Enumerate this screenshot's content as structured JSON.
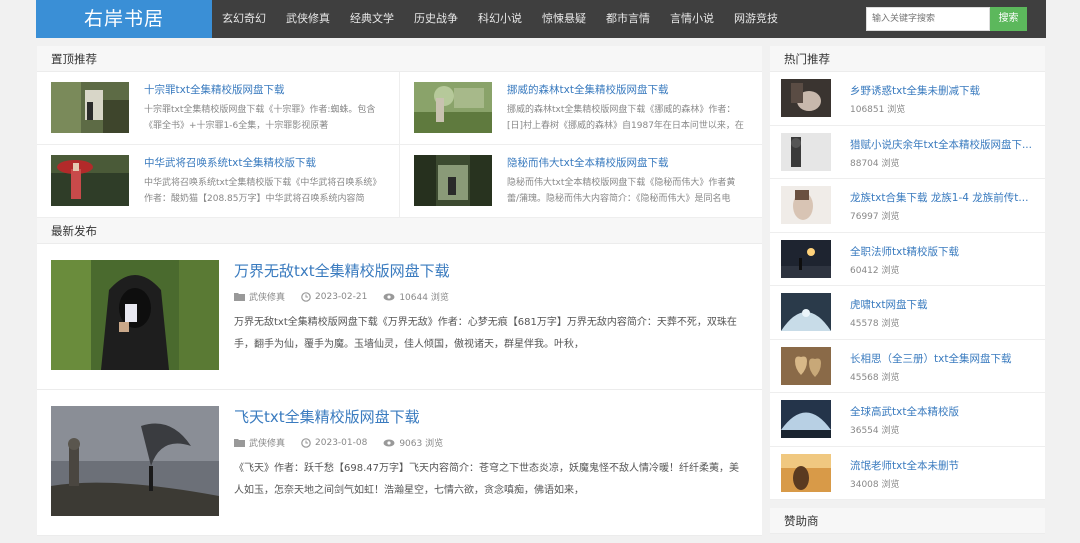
{
  "header": {
    "logo": "右岸书居",
    "menu": [
      "玄幻奇幻",
      "武侠修真",
      "经典文学",
      "历史战争",
      "科幻小说",
      "惊悚悬疑",
      "都市言情",
      "言情小说",
      "网游竞技"
    ],
    "search_placeholder": "输入关键字搜索",
    "search_button": "搜索"
  },
  "pinned": {
    "heading": "置顶推荐",
    "items": [
      {
        "title": "十宗罪txt全集精校版网盘下载",
        "desc": "十宗罪txt全集精校版网盘下载《十宗罪》作者:蜘蛛。包含《罪全书》+十宗罪1-6全集，十宗罪影视原著"
      },
      {
        "title": "挪威的森林txt全集精校版网盘下载",
        "desc": "挪威的森林txt全集精校版网盘下载《挪威的森林》作者：[日]村上春树《挪威的森林》自1987年在日本问世以来，在"
      },
      {
        "title": "中华武将召唤系统txt全集精校版下载",
        "desc": "中华武将召唤系统txt全集精校版下载《中华武将召唤系统》作者：酸奶猫【208.85万字】中华武将召唤系统内容简"
      },
      {
        "title": "隐秘而伟大txt全本精校版网盘下载",
        "desc": "隐秘而伟大txt全本精校版网盘下载《隐秘而伟大》作者黄蕾/蒲瑰。隐秘而伟大内容简介：《隐秘而伟大》是同名电"
      }
    ]
  },
  "latest": {
    "heading": "最新发布",
    "posts": [
      {
        "title": "万界无敌txt全集精校版网盘下载",
        "category": "武侠修真",
        "date": "2023-02-21",
        "views": "10644 浏览",
        "desc": "万界无敌txt全集精校版网盘下载《万界无敌》作者：心梦无痕【681万字】万界无敌内容简介：天葬不死，双珠在手，翻手为仙，覆手为魔。玉墙仙灵，佳人倾国，傲视诸天，群星伴我。叶秋，"
      },
      {
        "title": "飞天txt全集精校版网盘下载",
        "category": "武侠修真",
        "date": "2023-01-08",
        "views": "9063 浏览",
        "desc": "《飞天》作者：跃千愁【698.47万字】飞天内容简介：苍穹之下世态炎凉，妖魔鬼怪不敌人情冷暖！纤纤柔荑，美人如玉，怎奈天地之间剑气如虹！浩瀚星空，七情六欲，贪念嗔痴，佛语如来，"
      }
    ]
  },
  "hot": {
    "heading": "热门推荐",
    "items": [
      {
        "title": "乡野诱惑txt全集未删减下载",
        "views": "106851 浏览"
      },
      {
        "title": "猎赋小说庆余年txt全本精校版网盘下...",
        "views": "88704 浏览"
      },
      {
        "title": "龙族txt合集下载 龙族1-4 龙族前传t...",
        "views": "76997 浏览"
      },
      {
        "title": "全职法师txt精校版下载",
        "views": "60412 浏览"
      },
      {
        "title": "虎啸txt网盘下载",
        "views": "45578 浏览"
      },
      {
        "title": "长相思（全三册）txt全集网盘下载",
        "views": "45568 浏览"
      },
      {
        "title": "全球高武txt全本精校版",
        "views": "36554 浏览"
      },
      {
        "title": "流氓老师txt全本未删节",
        "views": "34008 浏览"
      }
    ]
  },
  "sponsor": {
    "heading": "赞助商"
  },
  "icons": {
    "category": "folder-icon",
    "date": "clock-icon",
    "views": "eye-icon"
  },
  "colors": {
    "accent": "#3a8fd6",
    "link": "#3a7bbf",
    "nav_bg": "#3f3f3f",
    "search_button": "#5cb85c"
  }
}
